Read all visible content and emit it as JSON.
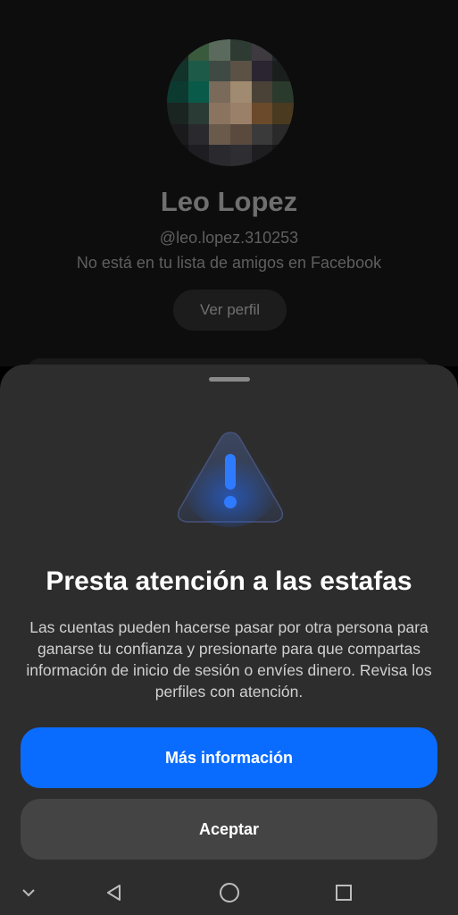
{
  "profile": {
    "name": "Leo Lopez",
    "handle": "@leo.lopez.310253",
    "relationship_note": "No está en tu lista de amigos en Facebook",
    "view_profile_label": "Ver perfil",
    "avatar": "pixelated-profile-photo"
  },
  "scam_sheet": {
    "icon": "warning-triangle-icon",
    "title": "Presta atención a las estafas",
    "body": "Las cuentas pueden hacerse pasar por otra persona para ganarse tu confianza y presionarte para que compartas información de inicio de sesión o envíes dinero. Revisa los perfiles con atención.",
    "more_info_label": "Más información",
    "accept_label": "Aceptar"
  },
  "system_nav": {
    "items": [
      "chevron-down-icon",
      "back-icon",
      "home-icon",
      "recents-icon"
    ]
  },
  "colors": {
    "primary_button": "#0a6cff",
    "secondary_button": "#444444",
    "sheet_background": "#2d2d2d",
    "warning_glow": "#1f6bff"
  }
}
